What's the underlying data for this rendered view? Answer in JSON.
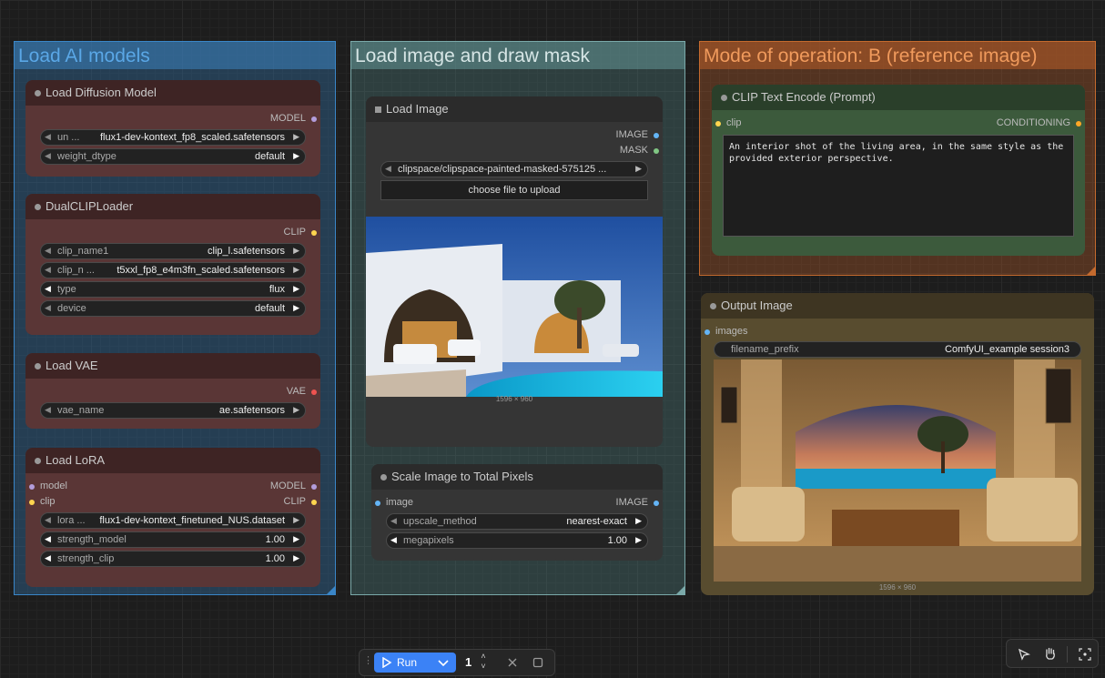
{
  "groups": {
    "models": "Load AI models",
    "image": "Load image and draw mask",
    "mode": "Mode of operation: B (reference image)"
  },
  "load_diffusion": {
    "title": "Load Diffusion Model",
    "out_model": "MODEL",
    "unet_name_label": "un ...",
    "unet_name_value": "flux1-dev-kontext_fp8_scaled.safetensors",
    "weight_dtype_label": "weight_dtype",
    "weight_dtype_value": "default"
  },
  "dualclip": {
    "title": "DualCLIPLoader",
    "out_clip": "CLIP",
    "clip1_label": "clip_name1",
    "clip1_value": "clip_l.safetensors",
    "clip2_label": "clip_n ...",
    "clip2_value": "t5xxl_fp8_e4m3fn_scaled.safetensors",
    "type_label": "type",
    "type_value": "flux",
    "device_label": "device",
    "device_value": "default"
  },
  "vae": {
    "title": "Load VAE",
    "out_vae": "VAE",
    "vae_label": "vae_name",
    "vae_value": "ae.safetensors"
  },
  "lora": {
    "title": "Load LoRA",
    "in_model": "model",
    "out_model": "MODEL",
    "in_clip": "clip",
    "out_clip": "CLIP",
    "lora_label": "lora ...",
    "lora_value": "flux1-dev-kontext_finetuned_NUS.dataset",
    "strength_model_label": "strength_model",
    "strength_model_value": "1.00",
    "strength_clip_label": "strength_clip",
    "strength_clip_value": "1.00"
  },
  "load_image": {
    "title": "Load Image",
    "out_image": "IMAGE",
    "out_mask": "MASK",
    "image_value": "clipspace/clipspace-painted-masked-575125 ...",
    "upload_label": "choose file to upload",
    "dims": "1596 × 960"
  },
  "scale": {
    "title": "Scale Image to Total Pixels",
    "in_image": "image",
    "out_image": "IMAGE",
    "method_label": "upscale_method",
    "method_value": "nearest-exact",
    "mp_label": "megapixels",
    "mp_value": "1.00"
  },
  "clip_text": {
    "title": "CLIP Text Encode (Prompt)",
    "in_clip": "clip",
    "out_cond": "CONDITIONING",
    "prompt": "An interior shot of the living area, in the same style as the provided exterior perspective."
  },
  "output": {
    "title": "Output Image",
    "in_images": "images",
    "prefix_label": "filename_prefix",
    "prefix_value": "ComfyUI_example session3",
    "dims": "1596 × 960"
  },
  "toolbar": {
    "run_label": "Run",
    "queue_count": "1"
  },
  "icons": {
    "run": "play-icon",
    "dropdown": "chevron-down-icon",
    "stepper": "stepper-icon",
    "clear": "close-icon",
    "stop": "square-icon",
    "select": "cursor-icon",
    "pan": "hand-icon",
    "fit": "fit-view-icon"
  },
  "colors": {
    "group_blue": "#3a86c8",
    "group_teal": "#7aa9a9",
    "group_orange": "#c46a2e",
    "run_button": "#3b82f6"
  }
}
